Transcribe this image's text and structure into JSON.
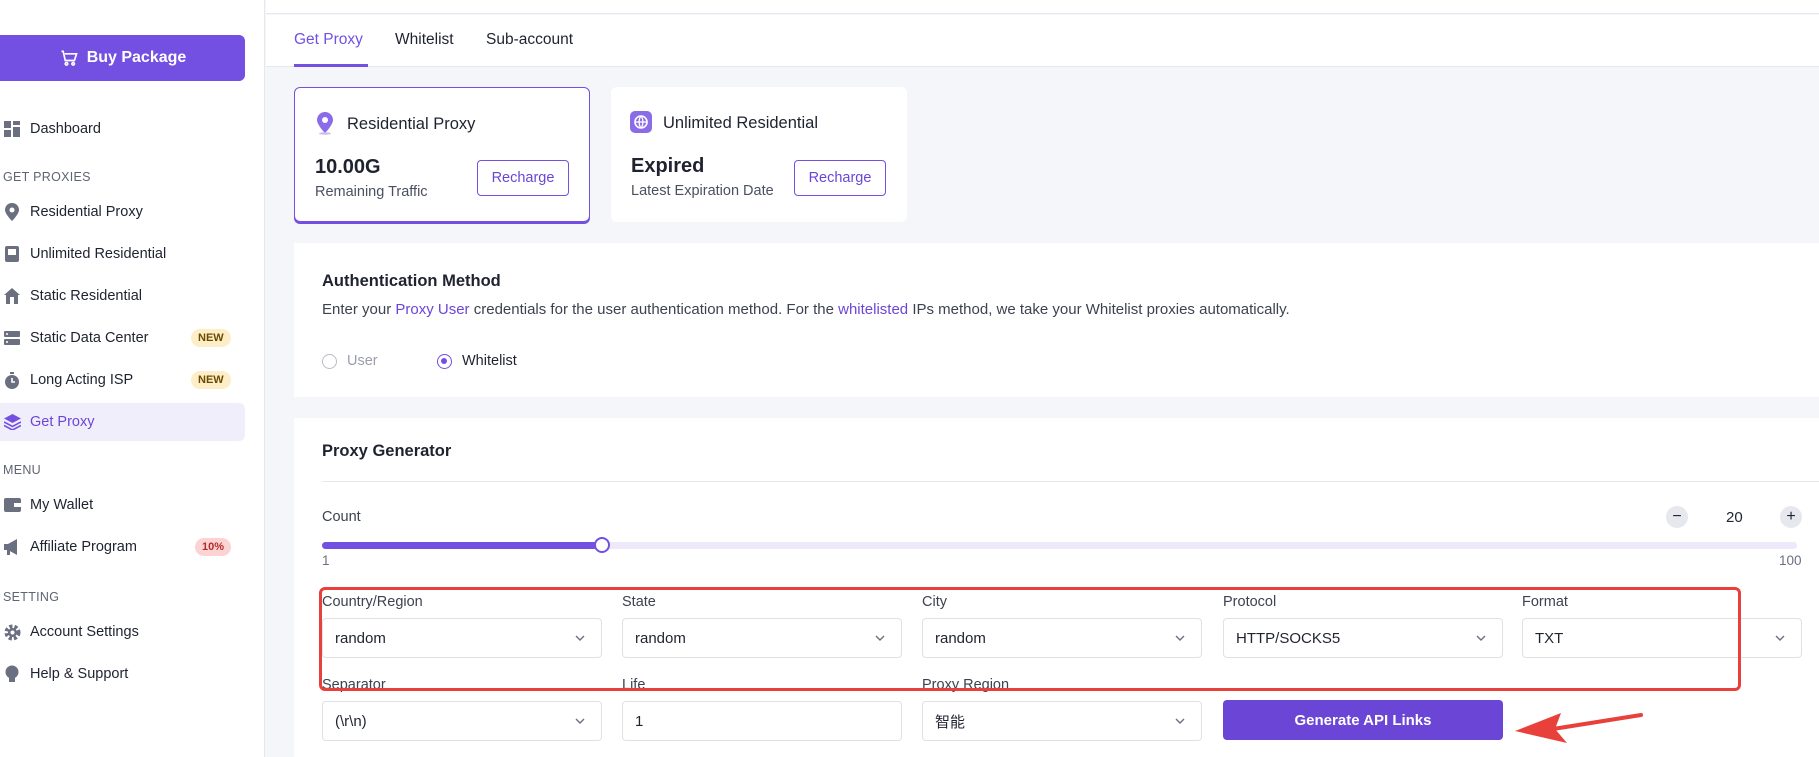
{
  "sidebar": {
    "buy_label": "Buy Package",
    "dashboard": "Dashboard",
    "section_get_proxies": "GET PROXIES",
    "items": [
      {
        "label": "Residential Proxy"
      },
      {
        "label": "Unlimited Residential"
      },
      {
        "label": "Static Residential"
      },
      {
        "label": "Static Data Center",
        "badge": "NEW"
      },
      {
        "label": "Long Acting ISP",
        "badge": "NEW"
      },
      {
        "label": "Get Proxy"
      }
    ],
    "section_menu": "MENU",
    "menu_items": [
      {
        "label": "My Wallet"
      },
      {
        "label": "Affiliate Program",
        "badge": "10%"
      }
    ],
    "section_setting": "SETTING",
    "setting_items": [
      {
        "label": "Account Settings"
      },
      {
        "label": "Help & Support"
      }
    ]
  },
  "tabs": [
    "Get Proxy",
    "Whitelist",
    "Sub-account"
  ],
  "cards": [
    {
      "title": "Residential Proxy",
      "value": "10.00G",
      "sub": "Remaining Traffic",
      "button": "Recharge"
    },
    {
      "title": "Unlimited Residential",
      "value": "Expired",
      "sub": "Latest Expiration Date",
      "button": "Recharge"
    }
  ],
  "auth": {
    "title": "Authentication Method",
    "desc_1": "Enter your ",
    "desc_link1": "Proxy User",
    "desc_2": " credentials for the user authentication method. For the ",
    "desc_link2": "whitelisted",
    "desc_3": " IPs method, we take your Whitelist proxies automatically.",
    "option_user": "User",
    "option_whitelist": "Whitelist",
    "selected": "Whitelist"
  },
  "generator": {
    "title": "Proxy Generator",
    "count_label": "Count",
    "count_value": "20",
    "min": "1",
    "max": "100",
    "slider_fraction": 0.19,
    "fields": {
      "country_label": "Country/Region",
      "country_value": "random",
      "state_label": "State",
      "state_value": "random",
      "city_label": "City",
      "city_value": "random",
      "protocol_label": "Protocol",
      "protocol_value": "HTTP/SOCKS5",
      "format_label": "Format",
      "format_value": "TXT",
      "separator_label": "Separator",
      "separator_value": "(\\r\\n)",
      "life_label": "Life",
      "life_value": "1",
      "region_label": "Proxy Region",
      "region_value": "智能"
    },
    "generate_label": "Generate API Links"
  },
  "colors": {
    "accent": "#7350e2",
    "highlight": "#e8403a"
  }
}
